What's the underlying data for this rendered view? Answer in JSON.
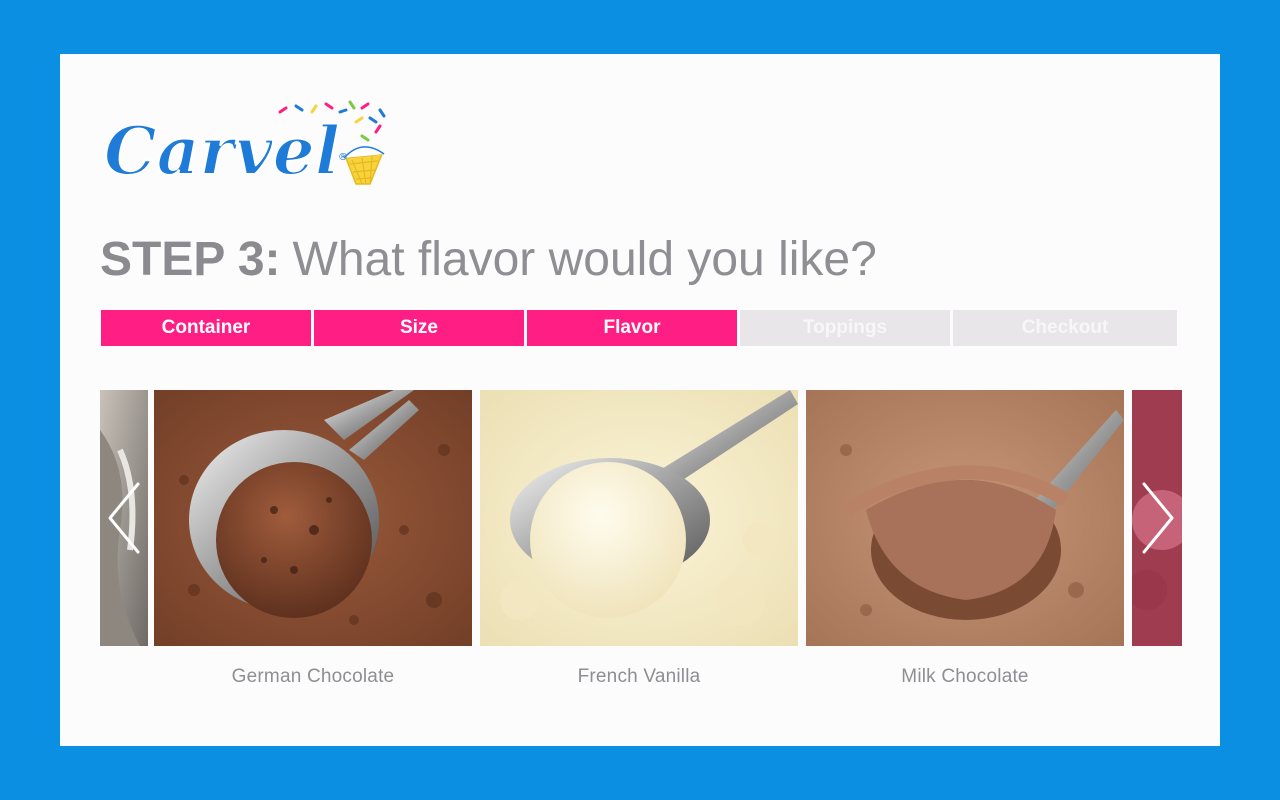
{
  "brand": {
    "logo_text": "Carvel",
    "registered_mark": "®",
    "colors": {
      "logo_blue": "#1e7bd8",
      "background_blue": "#0b8fe3",
      "accent_pink": "#ff1f84",
      "cone_yellow": "#f7d43b"
    }
  },
  "heading": {
    "step": "STEP 3:",
    "question": "What flavor would you like?"
  },
  "steps": [
    {
      "label": "Container",
      "state": "done"
    },
    {
      "label": "Size",
      "state": "done"
    },
    {
      "label": "Flavor",
      "state": "current"
    },
    {
      "label": "Toppings",
      "state": "todo"
    },
    {
      "label": "Checkout",
      "state": "todo"
    }
  ],
  "flavors": [
    {
      "name": "German Chocolate"
    },
    {
      "name": "French Vanilla"
    },
    {
      "name": "Milk Chocolate"
    }
  ],
  "icons": {
    "prev": "chevron-left-icon",
    "next": "chevron-right-icon"
  }
}
